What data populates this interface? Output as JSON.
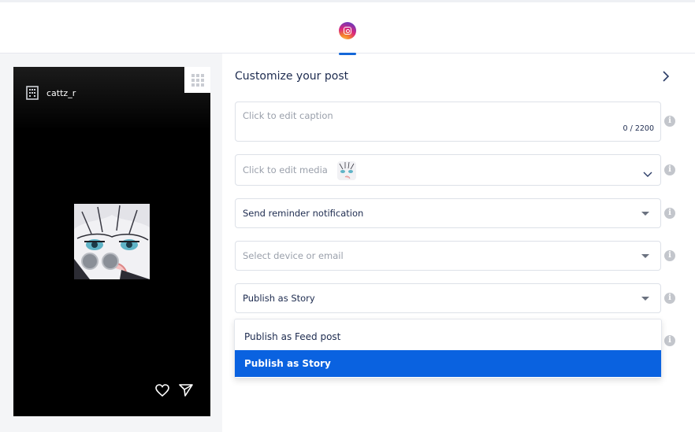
{
  "tabs": [
    {
      "name": "instagram",
      "icon": "instagram-icon",
      "active": true
    }
  ],
  "preview": {
    "account_name": "cattz_r",
    "account_icon": "building-icon",
    "grid_icon": "grid-icon",
    "media_icon": "anime-character-image",
    "actions": [
      "heart-icon",
      "send-icon"
    ]
  },
  "form": {
    "title": "Customize your post",
    "caption": {
      "placeholder": "Click to edit caption",
      "counter": "0 / 2200"
    },
    "media": {
      "placeholder": "Click to edit media"
    },
    "reminder": {
      "value": "Send reminder notification"
    },
    "device": {
      "placeholder": "Select device or email"
    },
    "publish": {
      "value": "Publish as Story"
    },
    "publish_options": [
      {
        "label": "Publish as Feed post",
        "selected": false
      },
      {
        "label": "Publish as Story",
        "selected": true
      }
    ]
  },
  "colors": {
    "accent": "#0a62e0",
    "text": "#1d2b4f"
  }
}
